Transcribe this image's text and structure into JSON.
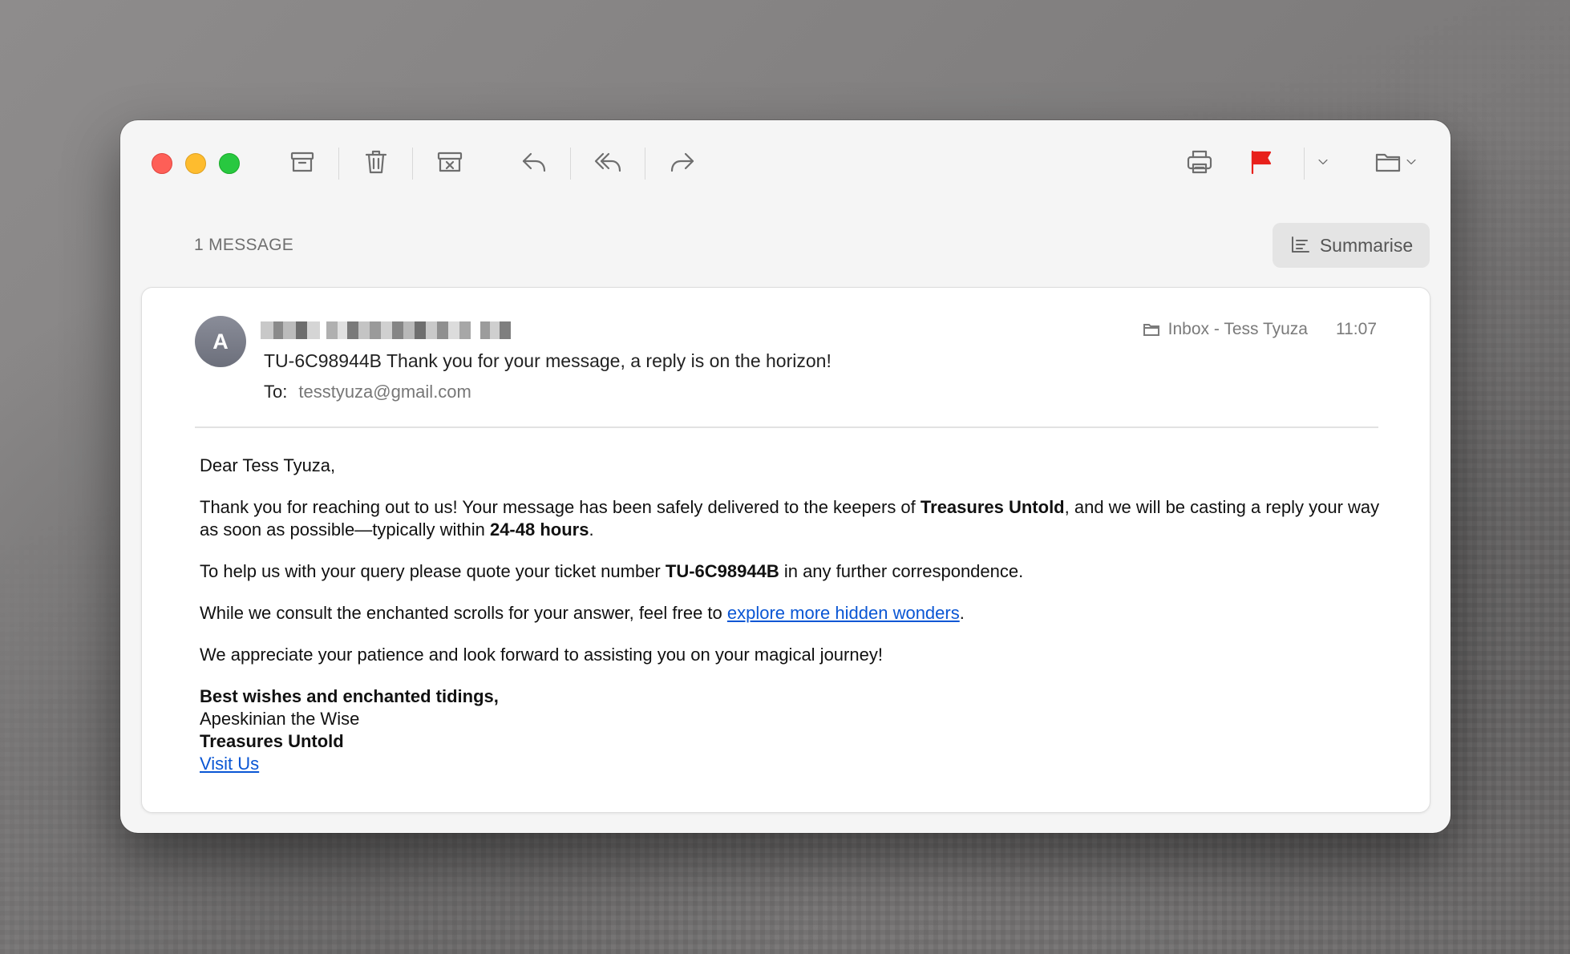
{
  "toolbar": {
    "archive": "archive-icon",
    "delete": "trash-icon",
    "junk": "junk-icon",
    "reply": "reply-icon",
    "reply_all": "reply-all-icon",
    "forward": "forward-icon",
    "print": "printer-icon",
    "flag": "flag-icon",
    "flag_color": "#e8201b",
    "move": "folder-icon"
  },
  "header": {
    "message_count": "1 MESSAGE",
    "summarise_label": "Summarise"
  },
  "message": {
    "avatar_initial": "A",
    "subject": "TU-6C98944B Thank you for your message, a reply is on the horizon!",
    "to_label": "To:",
    "to_address": "tesstyuza@gmail.com",
    "mailbox": "Inbox - Tess Tyuza",
    "time": "11:07"
  },
  "body": {
    "greeting": "Dear Tess Tyuza,",
    "p1_a": "Thank you for reaching out to us! Your message has been safely delivered to the keepers of ",
    "p1_bold": "Treasures Untold",
    "p1_b": ", and we will be casting a reply your way as soon as possible—typically within ",
    "p1_bold2": "24-48 hours",
    "p1_c": ".",
    "p2_a": "To help us with your query please quote your ticket number ",
    "p2_bold": "TU-6C98944B",
    "p2_b": " in any further correspondence.",
    "p3_a": "While we consult the enchanted scrolls for your answer, feel free to ",
    "p3_link": "explore more hidden wonders",
    "p3_b": ".",
    "p4": "We appreciate your patience and look forward to assisting you on your magical journey!",
    "sig_line1": "Best wishes and enchanted tidings,",
    "sig_line2": "Apeskinian the Wise",
    "sig_line3": "Treasures Untold",
    "sig_link": "Visit Us",
    "link_color": "#0a56d4"
  }
}
